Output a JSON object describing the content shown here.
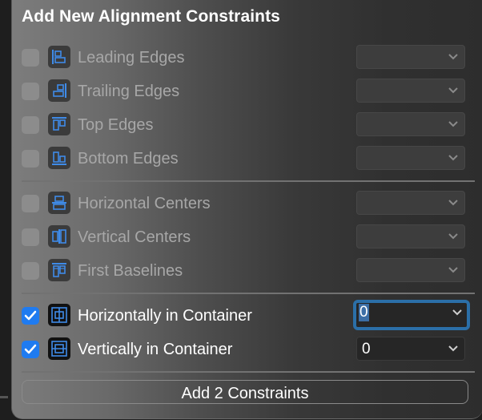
{
  "title": "Add New Alignment Constraints",
  "rows": [
    {
      "label": "Leading Edges",
      "icon": "leading-edges-icon",
      "checked": false,
      "value": ""
    },
    {
      "label": "Trailing Edges",
      "icon": "trailing-edges-icon",
      "checked": false,
      "value": ""
    },
    {
      "label": "Top Edges",
      "icon": "top-edges-icon",
      "checked": false,
      "value": ""
    },
    {
      "label": "Bottom Edges",
      "icon": "bottom-edges-icon",
      "checked": false,
      "value": ""
    },
    {
      "label": "Horizontal Centers",
      "icon": "horizontal-centers-icon",
      "checked": false,
      "value": ""
    },
    {
      "label": "Vertical Centers",
      "icon": "vertical-centers-icon",
      "checked": false,
      "value": ""
    },
    {
      "label": "First Baselines",
      "icon": "first-baselines-icon",
      "checked": false,
      "value": ""
    },
    {
      "label": "Horizontally in Container",
      "icon": "horizontally-in-container-icon",
      "checked": true,
      "value": "0"
    },
    {
      "label": "Vertically in Container",
      "icon": "vertically-in-container-icon",
      "checked": true,
      "value": "0"
    }
  ],
  "add_button_label": "Add 2 Constraints",
  "colors": {
    "accent": "#1f7bf0",
    "focus_ring": "#2b6fa8",
    "icon_blue": "#3f8be8"
  }
}
